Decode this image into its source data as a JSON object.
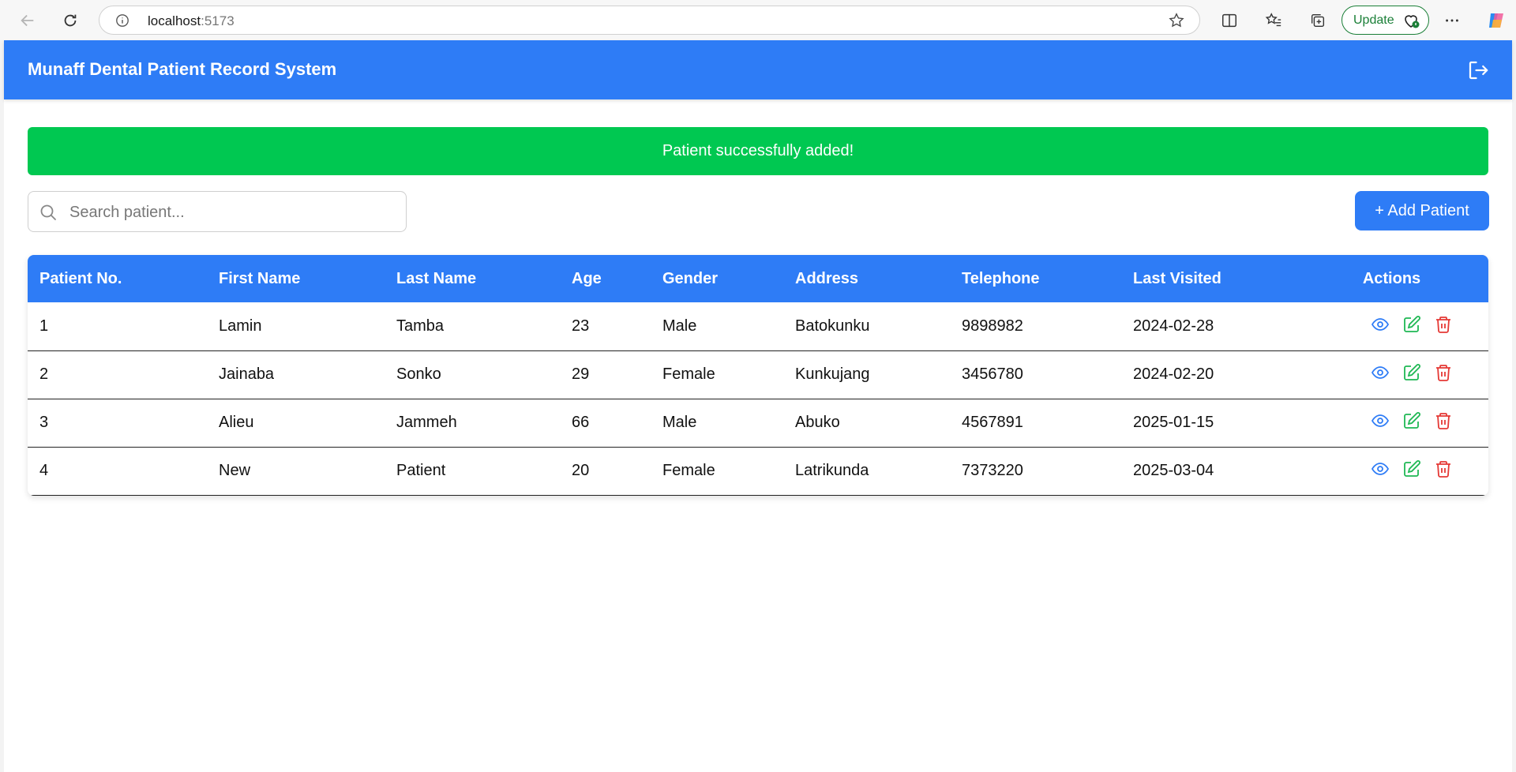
{
  "browser": {
    "url_host": "localhost",
    "url_port": ":5173",
    "update_label": "Update"
  },
  "app": {
    "title": "Munaff Dental Patient Record System"
  },
  "alert": {
    "message": "Patient successfully added!"
  },
  "search": {
    "placeholder": "Search patient..."
  },
  "toolbar": {
    "add_label": "+ Add Patient"
  },
  "table": {
    "columns": [
      "Patient No.",
      "First Name",
      "Last Name",
      "Age",
      "Gender",
      "Address",
      "Telephone",
      "Last Visited",
      "Actions"
    ],
    "rows": [
      {
        "no": "1",
        "first": "Lamin",
        "last": "Tamba",
        "age": "23",
        "gender": "Male",
        "address": "Batokunku",
        "phone": "9898982",
        "visited": "2024-02-28"
      },
      {
        "no": "2",
        "first": "Jainaba",
        "last": "Sonko",
        "age": "29",
        "gender": "Female",
        "address": "Kunkujang",
        "phone": "3456780",
        "visited": "2024-02-20"
      },
      {
        "no": "3",
        "first": "Alieu",
        "last": "Jammeh",
        "age": "66",
        "gender": "Male",
        "address": "Abuko",
        "phone": "4567891",
        "visited": "2025-01-15"
      },
      {
        "no": "4",
        "first": "New",
        "last": "Patient",
        "age": "20",
        "gender": "Female",
        "address": "Latrikunda",
        "phone": "7373220",
        "visited": "2025-03-04"
      }
    ]
  },
  "colors": {
    "primary": "#2e7cf6",
    "success": "#00c851",
    "view_icon": "#2e7cf6",
    "edit_icon": "#1fb854",
    "delete_icon": "#e53935"
  }
}
